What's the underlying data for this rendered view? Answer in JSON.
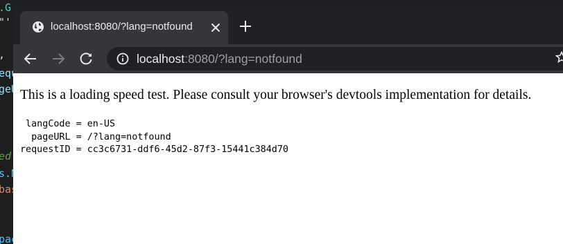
{
  "background_editor": {
    "lines": [
      {
        "text": ".G",
        "color": "#4ec9b0"
      },
      {
        "text": "\"'",
        "color": "#d4d4d4"
      },
      {
        "text": ",",
        "color": "#d4d4d4"
      },
      {
        "text": "equ",
        "color": "#9cdcfe"
      },
      {
        "text": "geU",
        "color": "#9cdcfe"
      },
      {
        "text": "ed",
        "color": "#6a9955"
      },
      {
        "text": "s.N",
        "color": "#4fc1ff"
      },
      {
        "text": "bas",
        "color": "#ce9178"
      },
      {
        "text": "pac",
        "color": "#4fc1ff"
      }
    ]
  },
  "browser": {
    "tab": {
      "title": "localhost:8080/?lang=notfound",
      "favicon": "globe-icon",
      "close_icon": "close-icon"
    },
    "new_tab_icon": "plus-icon",
    "toolbar": {
      "back_icon": "arrow-left-icon",
      "forward_icon": "arrow-right-icon",
      "reload_icon": "reload-icon",
      "site_info_icon": "info-icon",
      "url_host": "localhost",
      "url_rest": ":8080/?lang=notfound",
      "bookmark_icon": "star-icon"
    },
    "colors": {
      "frame": "#202124",
      "active_tab": "#35363a",
      "text": "#e8eaed",
      "muted_text": "#9aa0a6",
      "page": "#ffffff"
    }
  },
  "page": {
    "intro": "This is a loading speed test. Please consult your browser's devtools implementation for details.",
    "info_text": " langCode = en-US\n  pageURL = /?lang=notfound\nrequestID = cc3c6731-ddf6-45d2-87f3-15441c384d70"
  }
}
